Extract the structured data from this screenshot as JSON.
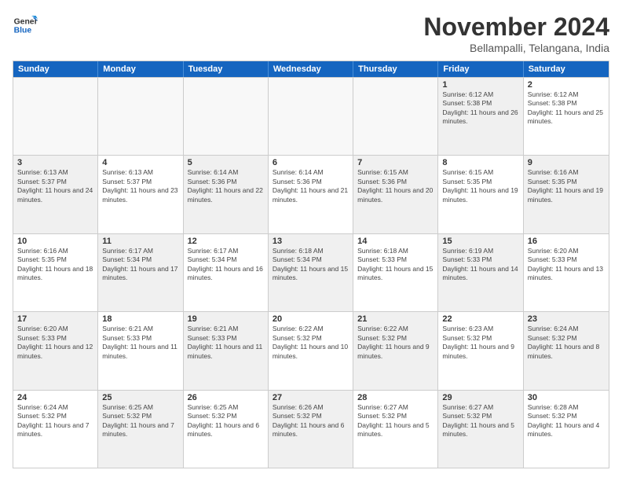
{
  "logo": {
    "general": "General",
    "blue": "Blue"
  },
  "title": "November 2024",
  "location": "Bellampalli, Telangana, India",
  "weekdays": [
    "Sunday",
    "Monday",
    "Tuesday",
    "Wednesday",
    "Thursday",
    "Friday",
    "Saturday"
  ],
  "rows": [
    [
      {
        "day": "",
        "empty": true
      },
      {
        "day": "",
        "empty": true
      },
      {
        "day": "",
        "empty": true
      },
      {
        "day": "",
        "empty": true
      },
      {
        "day": "",
        "empty": true
      },
      {
        "day": "1",
        "sunrise": "Sunrise: 6:12 AM",
        "sunset": "Sunset: 5:38 PM",
        "daylight": "Daylight: 11 hours and 26 minutes."
      },
      {
        "day": "2",
        "sunrise": "Sunrise: 6:12 AM",
        "sunset": "Sunset: 5:38 PM",
        "daylight": "Daylight: 11 hours and 25 minutes."
      }
    ],
    [
      {
        "day": "3",
        "sunrise": "Sunrise: 6:13 AM",
        "sunset": "Sunset: 5:37 PM",
        "daylight": "Daylight: 11 hours and 24 minutes."
      },
      {
        "day": "4",
        "sunrise": "Sunrise: 6:13 AM",
        "sunset": "Sunset: 5:37 PM",
        "daylight": "Daylight: 11 hours and 23 minutes."
      },
      {
        "day": "5",
        "sunrise": "Sunrise: 6:14 AM",
        "sunset": "Sunset: 5:36 PM",
        "daylight": "Daylight: 11 hours and 22 minutes."
      },
      {
        "day": "6",
        "sunrise": "Sunrise: 6:14 AM",
        "sunset": "Sunset: 5:36 PM",
        "daylight": "Daylight: 11 hours and 21 minutes."
      },
      {
        "day": "7",
        "sunrise": "Sunrise: 6:15 AM",
        "sunset": "Sunset: 5:36 PM",
        "daylight": "Daylight: 11 hours and 20 minutes."
      },
      {
        "day": "8",
        "sunrise": "Sunrise: 6:15 AM",
        "sunset": "Sunset: 5:35 PM",
        "daylight": "Daylight: 11 hours and 19 minutes."
      },
      {
        "day": "9",
        "sunrise": "Sunrise: 6:16 AM",
        "sunset": "Sunset: 5:35 PM",
        "daylight": "Daylight: 11 hours and 19 minutes."
      }
    ],
    [
      {
        "day": "10",
        "sunrise": "Sunrise: 6:16 AM",
        "sunset": "Sunset: 5:35 PM",
        "daylight": "Daylight: 11 hours and 18 minutes."
      },
      {
        "day": "11",
        "sunrise": "Sunrise: 6:17 AM",
        "sunset": "Sunset: 5:34 PM",
        "daylight": "Daylight: 11 hours and 17 minutes."
      },
      {
        "day": "12",
        "sunrise": "Sunrise: 6:17 AM",
        "sunset": "Sunset: 5:34 PM",
        "daylight": "Daylight: 11 hours and 16 minutes."
      },
      {
        "day": "13",
        "sunrise": "Sunrise: 6:18 AM",
        "sunset": "Sunset: 5:34 PM",
        "daylight": "Daylight: 11 hours and 15 minutes."
      },
      {
        "day": "14",
        "sunrise": "Sunrise: 6:18 AM",
        "sunset": "Sunset: 5:33 PM",
        "daylight": "Daylight: 11 hours and 15 minutes."
      },
      {
        "day": "15",
        "sunrise": "Sunrise: 6:19 AM",
        "sunset": "Sunset: 5:33 PM",
        "daylight": "Daylight: 11 hours and 14 minutes."
      },
      {
        "day": "16",
        "sunrise": "Sunrise: 6:20 AM",
        "sunset": "Sunset: 5:33 PM",
        "daylight": "Daylight: 11 hours and 13 minutes."
      }
    ],
    [
      {
        "day": "17",
        "sunrise": "Sunrise: 6:20 AM",
        "sunset": "Sunset: 5:33 PM",
        "daylight": "Daylight: 11 hours and 12 minutes."
      },
      {
        "day": "18",
        "sunrise": "Sunrise: 6:21 AM",
        "sunset": "Sunset: 5:33 PM",
        "daylight": "Daylight: 11 hours and 11 minutes."
      },
      {
        "day": "19",
        "sunrise": "Sunrise: 6:21 AM",
        "sunset": "Sunset: 5:33 PM",
        "daylight": "Daylight: 11 hours and 11 minutes."
      },
      {
        "day": "20",
        "sunrise": "Sunrise: 6:22 AM",
        "sunset": "Sunset: 5:32 PM",
        "daylight": "Daylight: 11 hours and 10 minutes."
      },
      {
        "day": "21",
        "sunrise": "Sunrise: 6:22 AM",
        "sunset": "Sunset: 5:32 PM",
        "daylight": "Daylight: 11 hours and 9 minutes."
      },
      {
        "day": "22",
        "sunrise": "Sunrise: 6:23 AM",
        "sunset": "Sunset: 5:32 PM",
        "daylight": "Daylight: 11 hours and 9 minutes."
      },
      {
        "day": "23",
        "sunrise": "Sunrise: 6:24 AM",
        "sunset": "Sunset: 5:32 PM",
        "daylight": "Daylight: 11 hours and 8 minutes."
      }
    ],
    [
      {
        "day": "24",
        "sunrise": "Sunrise: 6:24 AM",
        "sunset": "Sunset: 5:32 PM",
        "daylight": "Daylight: 11 hours and 7 minutes."
      },
      {
        "day": "25",
        "sunrise": "Sunrise: 6:25 AM",
        "sunset": "Sunset: 5:32 PM",
        "daylight": "Daylight: 11 hours and 7 minutes."
      },
      {
        "day": "26",
        "sunrise": "Sunrise: 6:25 AM",
        "sunset": "Sunset: 5:32 PM",
        "daylight": "Daylight: 11 hours and 6 minutes."
      },
      {
        "day": "27",
        "sunrise": "Sunrise: 6:26 AM",
        "sunset": "Sunset: 5:32 PM",
        "daylight": "Daylight: 11 hours and 6 minutes."
      },
      {
        "day": "28",
        "sunrise": "Sunrise: 6:27 AM",
        "sunset": "Sunset: 5:32 PM",
        "daylight": "Daylight: 11 hours and 5 minutes."
      },
      {
        "day": "29",
        "sunrise": "Sunrise: 6:27 AM",
        "sunset": "Sunset: 5:32 PM",
        "daylight": "Daylight: 11 hours and 5 minutes."
      },
      {
        "day": "30",
        "sunrise": "Sunrise: 6:28 AM",
        "sunset": "Sunset: 5:32 PM",
        "daylight": "Daylight: 11 hours and 4 minutes."
      }
    ]
  ]
}
